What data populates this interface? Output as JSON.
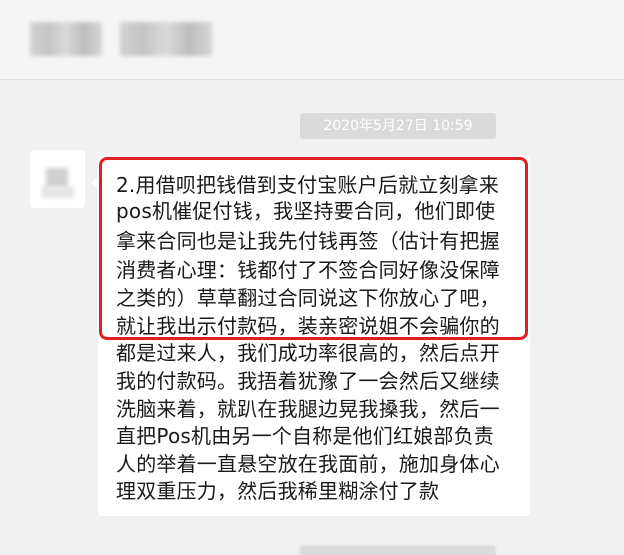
{
  "conversation": {
    "timestamp": "2020年5月27日 10:59",
    "message_lines": [
      "2.用借呗把钱借到支付宝账户后就立刻拿来",
      "pos机催促付钱，我坚持要合同，他们即使",
      "拿来合同也是让我先付钱再签（估计有把握",
      "消费者心理：钱都付了不签合同好像没保障",
      "之类的）草草翻过合同说这下你放心了吧，",
      "就让我出示付款码，装亲密说姐不会骗你的",
      "都是过来人，我们成功率很高的，然后点开",
      "我的付款码。我捂着犹豫了一会然后又继续",
      "洗脑来着，就趴在我腿边晃我搡我，然后一",
      "直把Pos机由另一个自称是他们红娘部负责",
      "人的举着一直悬空放在我面前，施加身体心",
      "理双重压力，然后我稀里糊涂付了款"
    ]
  },
  "colors": {
    "background": "#f1f1f1",
    "bubble": "#ffffff",
    "highlight": "#e02020",
    "time_chip": "#dadada"
  }
}
